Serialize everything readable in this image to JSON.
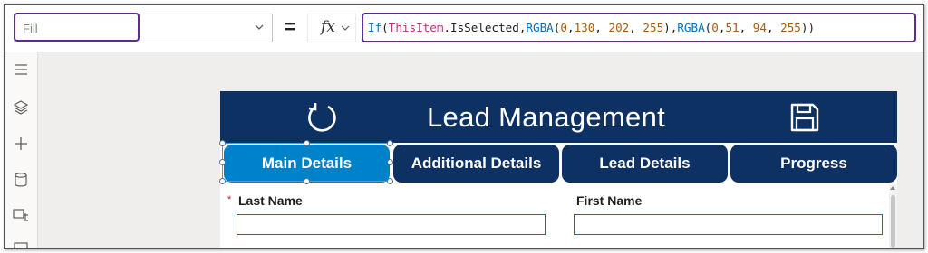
{
  "formula_bar": {
    "property": "Fill",
    "equals": "=",
    "fx": "fx",
    "formula_tokens": [
      {
        "t": "If",
        "k": "fn"
      },
      {
        "t": "(",
        "k": "pun"
      },
      {
        "t": "ThisItem",
        "k": "obj"
      },
      {
        "t": ".IsSelected,",
        "k": "pun"
      },
      {
        "t": "RGBA",
        "k": "fn"
      },
      {
        "t": "(",
        "k": "pun"
      },
      {
        "t": "0",
        "k": "num"
      },
      {
        "t": ",",
        "k": "pun"
      },
      {
        "t": "130",
        "k": "num"
      },
      {
        "t": ", ",
        "k": "pun"
      },
      {
        "t": "202",
        "k": "num"
      },
      {
        "t": ", ",
        "k": "pun"
      },
      {
        "t": "255",
        "k": "num"
      },
      {
        "t": "),",
        "k": "pun"
      },
      {
        "t": "RGBA",
        "k": "fn"
      },
      {
        "t": "(",
        "k": "pun"
      },
      {
        "t": "0",
        "k": "num"
      },
      {
        "t": ",",
        "k": "pun"
      },
      {
        "t": "51",
        "k": "num"
      },
      {
        "t": ", ",
        "k": "pun"
      },
      {
        "t": "94",
        "k": "num"
      },
      {
        "t": ", ",
        "k": "pun"
      },
      {
        "t": "255",
        "k": "num"
      },
      {
        "t": "))",
        "k": "pun"
      }
    ]
  },
  "left_rail": {
    "icons": [
      "hamburger-icon",
      "layers-icon",
      "plus-icon",
      "database-icon",
      "media-icon",
      "tools-icon"
    ]
  },
  "app": {
    "title": "Lead Management",
    "header_icons": [
      "refresh-icon",
      "save-icon"
    ],
    "tabs": [
      {
        "label": "Main Details",
        "selected": true
      },
      {
        "label": "Additional Details",
        "selected": false
      },
      {
        "label": "Lead Details",
        "selected": false
      },
      {
        "label": "Progress",
        "selected": false
      }
    ],
    "fields": [
      {
        "label": "Last Name",
        "required": true,
        "value": ""
      },
      {
        "label": "First Name",
        "required": false,
        "value": ""
      }
    ],
    "required_mark": "*"
  },
  "colors": {
    "selected_tab": "#0082CA",
    "unselected_tab": "#00335E",
    "header": "#0E3164",
    "highlight_border": "#5C2D91"
  }
}
